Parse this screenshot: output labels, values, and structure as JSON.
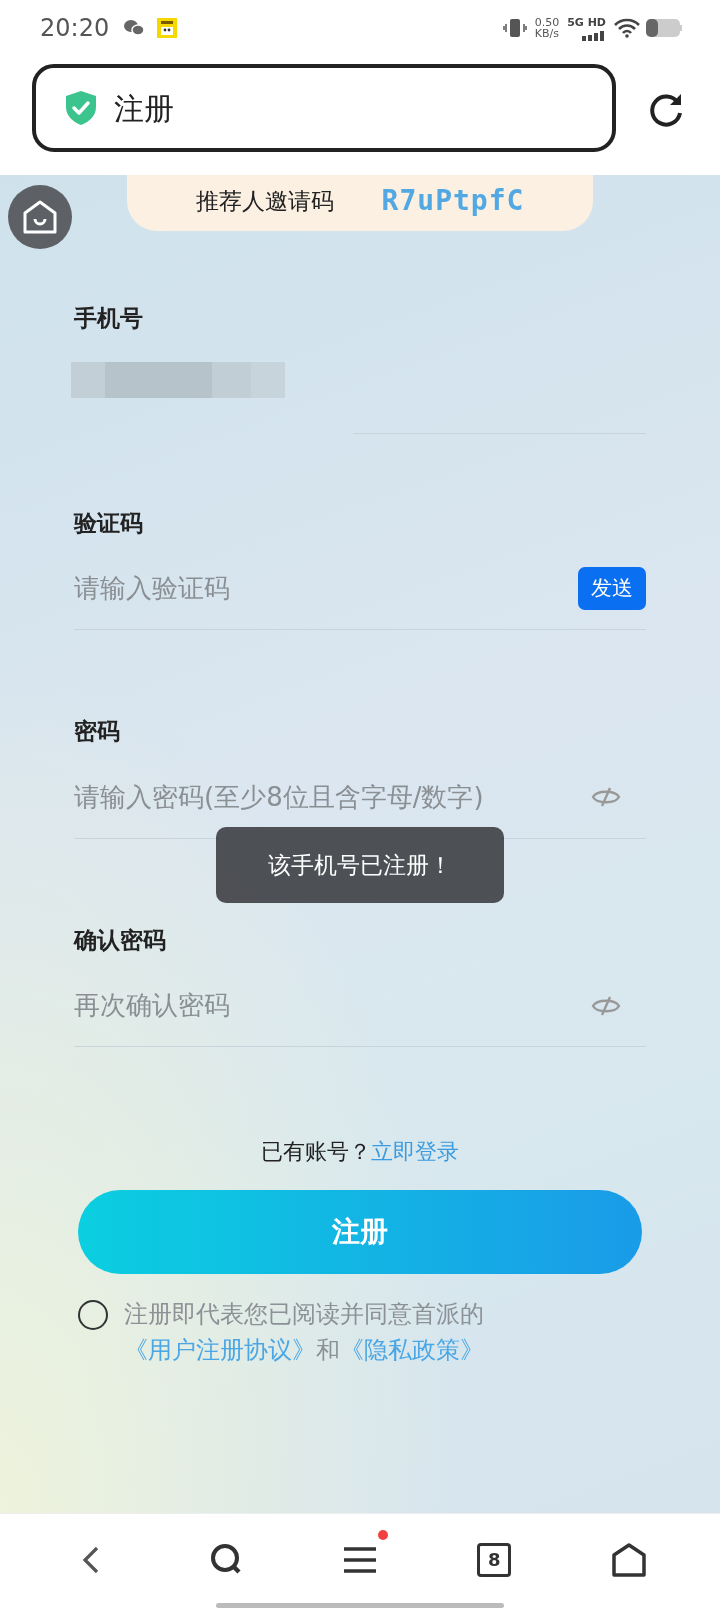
{
  "status_bar": {
    "time": "20:20",
    "net_speed": "0.50",
    "net_unit": "KB/s",
    "network": "5G HD"
  },
  "address_bar": {
    "title": "注册"
  },
  "invite": {
    "label": "推荐人邀请码",
    "code": "R7uPtpfC"
  },
  "fields": [
    {
      "kind": "redacted",
      "label": "手机号"
    },
    {
      "kind": "code",
      "label": "验证码",
      "placeholder": "请输入验证码",
      "button": "发送"
    },
    {
      "kind": "password",
      "label": "密码",
      "placeholder": "请输入密码(至少8位且含字母/数字)"
    },
    {
      "kind": "password",
      "label": "确认密码",
      "placeholder": "再次确认密码"
    }
  ],
  "toast": "该手机号已注册！",
  "login_prompt": {
    "text": "已有账号？",
    "link": "立即登录"
  },
  "submit": "注册",
  "agreement": {
    "checked": false,
    "parts": [
      {
        "kind": "text",
        "text": "注册即代表您已阅读并同意首派的"
      },
      {
        "kind": "link",
        "text": "《用户注册协议》"
      },
      {
        "kind": "text",
        "text": "和"
      },
      {
        "kind": "link",
        "text": "《隐私政策》"
      }
    ]
  },
  "bottom_nav": [
    {
      "kind": "back"
    },
    {
      "kind": "search"
    },
    {
      "kind": "menu",
      "badge": true
    },
    {
      "kind": "tabs",
      "count": "8"
    },
    {
      "kind": "home"
    }
  ]
}
